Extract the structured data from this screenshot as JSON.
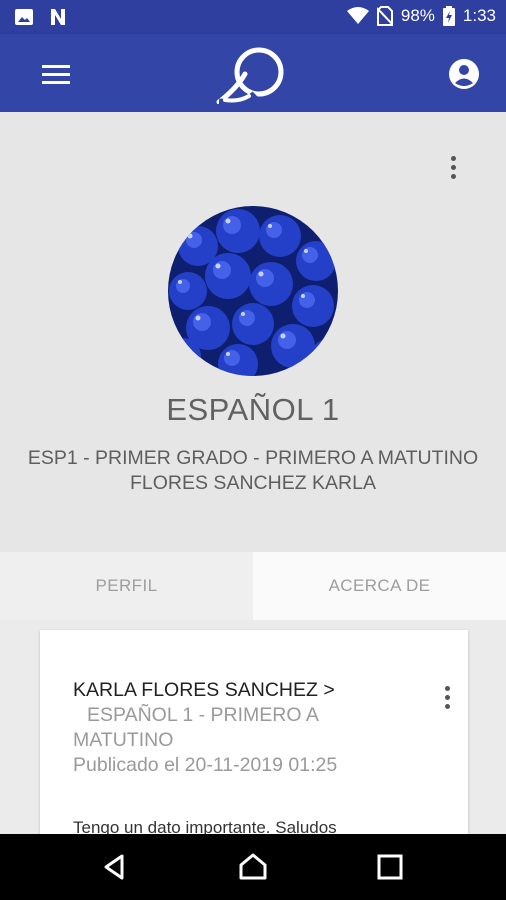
{
  "status_bar": {
    "battery": "98%",
    "time": "1:33",
    "icons": [
      "image-icon",
      "n-app-icon",
      "wifi-icon",
      "no-sim-icon",
      "battery-charging-icon"
    ]
  },
  "app_bar": {
    "icons": [
      "menu-icon",
      "app-logo",
      "account-icon"
    ]
  },
  "course": {
    "title": "ESPAÑOL 1",
    "subtitle_line1": "ESP1 - PRIMER GRADO - PRIMERO A MATUTINO",
    "subtitle_line2": "FLORES SANCHEZ KARLA"
  },
  "tabs": [
    {
      "label": "PERFIL",
      "selected": false
    },
    {
      "label": "ACERCA DE",
      "selected": true
    }
  ],
  "post": {
    "author": "KARLA FLORES SANCHEZ >",
    "course": "ESPAÑOL 1 - PRIMERO A MATUTINO",
    "date": "Publicado el 20-11-2019 01:25",
    "body": "Tengo un dato importante. Saludos"
  },
  "colors": {
    "status_bar": "#2f3fa0",
    "app_bar": "#3346a8",
    "header_bg": "#e6e6e6",
    "nav_bar": "#000000"
  }
}
